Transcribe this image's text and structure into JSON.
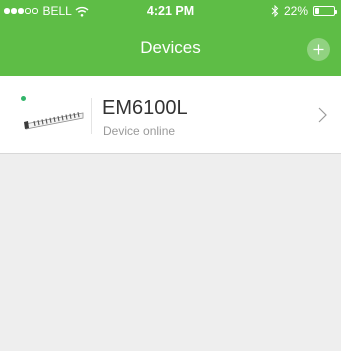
{
  "status_bar": {
    "signal_dots": [
      true,
      true,
      true,
      false,
      false
    ],
    "carrier": "BELL",
    "time": "4:21 PM",
    "battery_percent": "22%",
    "battery_level": 0.22
  },
  "nav": {
    "title": "Devices",
    "add_icon": "plus-icon"
  },
  "devices": [
    {
      "name": "EM6100L",
      "status": "Device online",
      "online": true,
      "icon": "power-strip-icon"
    }
  ],
  "colors": {
    "header_green": "#5ebd46",
    "online_green": "#33b56a",
    "background": "#eeeeee"
  }
}
